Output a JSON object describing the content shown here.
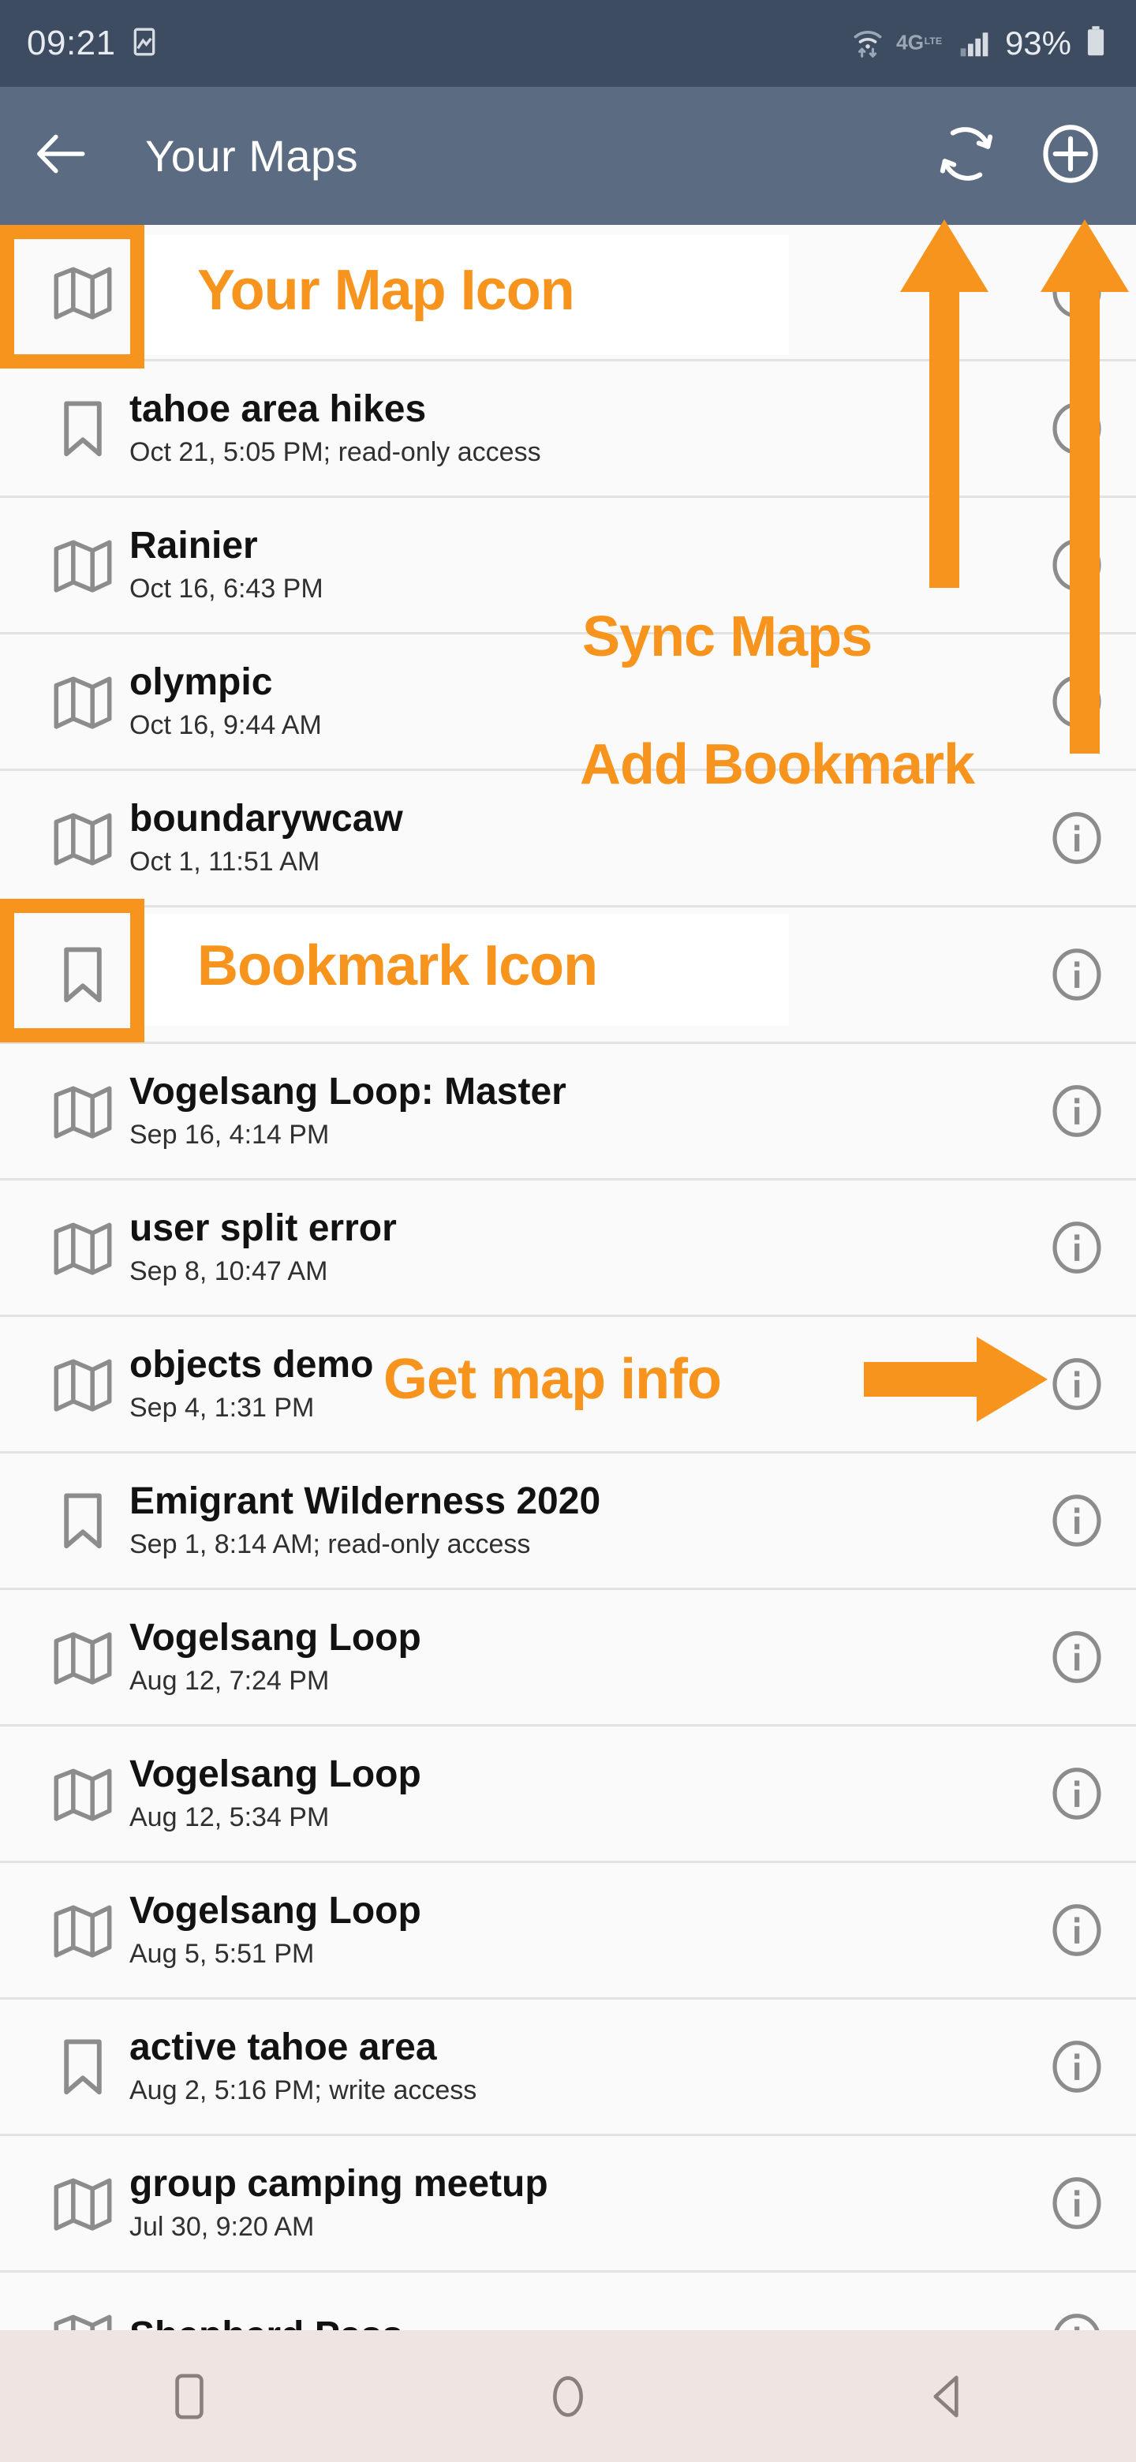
{
  "status_bar": {
    "time": "09:21",
    "battery_percent": "93%",
    "network": "4G LTE",
    "icons": [
      "image-icon",
      "wifi-icon",
      "network-4glte-icon",
      "signal-bars-icon",
      "battery-icon"
    ]
  },
  "app_bar": {
    "back_label": "back-arrow",
    "title": "Your Maps",
    "sync_label": "sync-maps",
    "add_label": "add-bookmark"
  },
  "annotations": {
    "your_map_icon": "Your Map Icon",
    "bookmark_icon": "Bookmark Icon",
    "sync_maps": "Sync Maps",
    "add_bookmark": "Add Bookmark",
    "get_map_info": "Get map info",
    "color": "#F7941D"
  },
  "list": {
    "rows": [
      {
        "icon": "map-icon",
        "title": "",
        "sub": ""
      },
      {
        "icon": "bookmark-icon",
        "title": "tahoe area hikes",
        "sub": "Oct 21, 5:05 PM; read-only access"
      },
      {
        "icon": "map-icon",
        "title": "Rainier",
        "sub": "Oct 16, 6:43 PM"
      },
      {
        "icon": "map-icon",
        "title": "olympic",
        "sub": "Oct 16, 9:44 AM"
      },
      {
        "icon": "map-icon",
        "title": "boundarywcaw",
        "sub": "Oct 1, 11:51 AM"
      },
      {
        "icon": "bookmark-icon",
        "title": "",
        "sub": ""
      },
      {
        "icon": "map-icon",
        "title": "Vogelsang Loop: Master",
        "sub": "Sep 16, 4:14 PM"
      },
      {
        "icon": "map-icon",
        "title": "user split error",
        "sub": "Sep 8, 10:47 AM"
      },
      {
        "icon": "map-icon",
        "title": "objects demo",
        "sub": "Sep 4, 1:31 PM"
      },
      {
        "icon": "bookmark-icon",
        "title": "Emigrant Wilderness 2020",
        "sub": "Sep 1, 8:14 AM; read-only access"
      },
      {
        "icon": "map-icon",
        "title": "Vogelsang Loop",
        "sub": "Aug 12, 7:24 PM"
      },
      {
        "icon": "map-icon",
        "title": "Vogelsang Loop",
        "sub": "Aug 12, 5:34 PM"
      },
      {
        "icon": "map-icon",
        "title": "Vogelsang Loop",
        "sub": "Aug 5, 5:51 PM"
      },
      {
        "icon": "bookmark-icon",
        "title": "active tahoe area",
        "sub": "Aug 2, 5:16 PM; write access"
      },
      {
        "icon": "map-icon",
        "title": "group camping meetup",
        "sub": "Jul 30, 9:20 AM"
      },
      {
        "icon": "map-icon",
        "title": "Shepherd Pass",
        "sub": ""
      }
    ],
    "info_label": "info-icon"
  },
  "nav_bar": {
    "recents_label": "recents-square-icon",
    "home_label": "home-circle-icon",
    "back_label": "back-triangle-icon"
  }
}
